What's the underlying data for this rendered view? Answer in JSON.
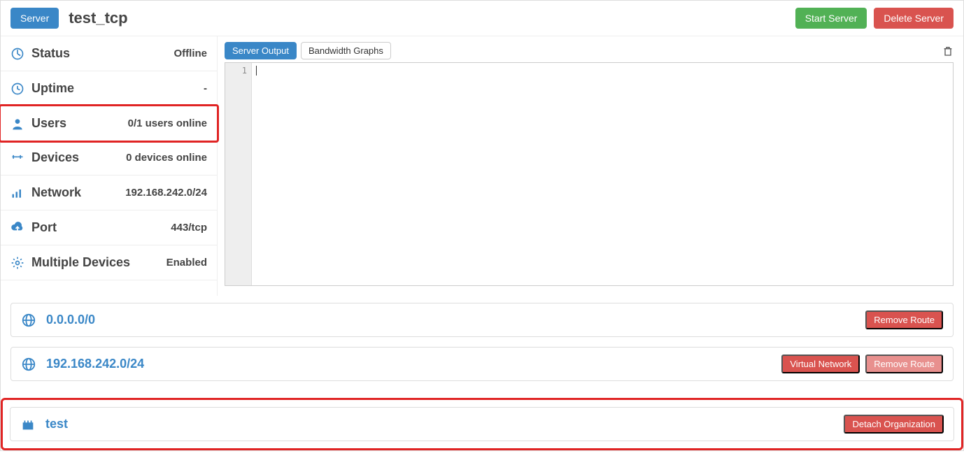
{
  "header": {
    "server_badge": "Server",
    "server_name": "test_tcp",
    "start_btn": "Start Server",
    "delete_btn": "Delete Server"
  },
  "sidebar": {
    "status": {
      "label": "Status",
      "value": "Offline"
    },
    "uptime": {
      "label": "Uptime",
      "value": "-"
    },
    "users": {
      "label": "Users",
      "value": "0/1 users online"
    },
    "devices": {
      "label": "Devices",
      "value": "0 devices online"
    },
    "network": {
      "label": "Network",
      "value": "192.168.242.0/24"
    },
    "port": {
      "label": "Port",
      "value": "443/tcp"
    },
    "multidev": {
      "label": "Multiple Devices",
      "value": "Enabled"
    }
  },
  "tabs": {
    "output": "Server Output",
    "bandwidth": "Bandwidth Graphs"
  },
  "editor": {
    "line1": "1"
  },
  "routes": {
    "r1": {
      "cidr": "0.0.0.0/0",
      "remove": "Remove Route"
    },
    "r2": {
      "cidr": "192.168.242.0/24",
      "virtual": "Virtual Network",
      "remove": "Remove Route"
    }
  },
  "org": {
    "name": "test",
    "detach": "Detach Organization"
  }
}
